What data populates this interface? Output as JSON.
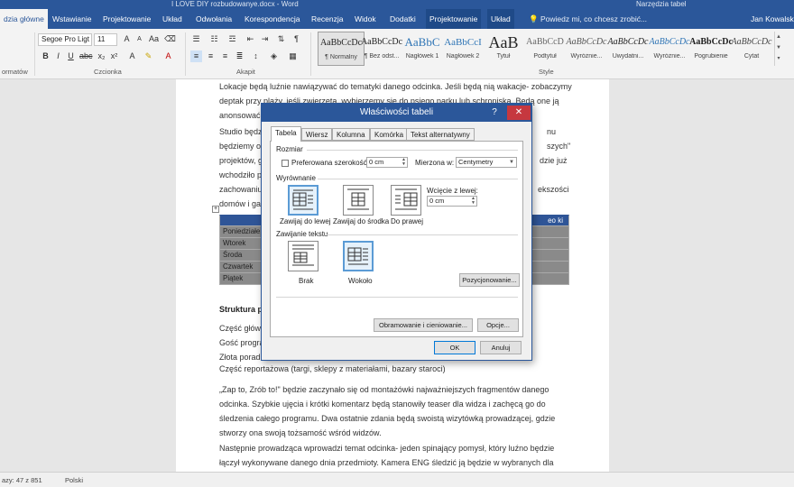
{
  "titlebar": {
    "title": "I LOVE DIY rozbudowanye.docx - Word",
    "context": "Narzędzia tabel"
  },
  "tabs": [
    {
      "label": "dzia główne"
    },
    {
      "label": "Wstawianie"
    },
    {
      "label": "Projektowanie"
    },
    {
      "label": "Układ"
    },
    {
      "label": "Odwołania"
    },
    {
      "label": "Korespondencja"
    },
    {
      "label": "Recenzja"
    },
    {
      "label": "Widok"
    },
    {
      "label": "Dodatki"
    },
    {
      "label": "Projektowanie"
    },
    {
      "label": "Układ"
    }
  ],
  "tellme": "Powiedz mi, co chcesz zrobić...",
  "user": "Jan Kowalski",
  "ribbon": {
    "font_name": "Segoe Pro Ligt",
    "font_size": "11",
    "font_group": "Czcionka",
    "paragraph_group": "Akapit",
    "styles_group": "Style",
    "clipboard_group": "ormatów",
    "styles": [
      {
        "preview": "AaBbCcDc",
        "name": "¶ Normalny"
      },
      {
        "preview": "AaBbCcDc",
        "name": "¶ Bez odst..."
      },
      {
        "preview": "AaBbC",
        "name": "Nagłówek 1"
      },
      {
        "preview": "AaBbCcI",
        "name": "Nagłówek 2"
      },
      {
        "preview": "AaB",
        "name": "Tytuł"
      },
      {
        "preview": "AaBbCcD",
        "name": "Podtytuł"
      },
      {
        "preview": "AaBbCcDc",
        "name": "Wyróżnie..."
      },
      {
        "preview": "AaBbCcDc",
        "name": "Uwydatni..."
      },
      {
        "preview": "AaBbCcDc",
        "name": "Wyróżnie..."
      },
      {
        "preview": "AaBbCcDc",
        "name": "Pogrubienie"
      },
      {
        "preview": "AaBbCcDc",
        "name": "Cytat"
      }
    ]
  },
  "document": {
    "p1": "Lokacje będą luźnie nawiązywać do tematyki danego odcinka. Jeśli będą nią wakacje- zobaczymy deptak przy plaży, jeśli zwierzęta, wybierzemy się do psiego parku lub schroniska. Będą one ją anonsować",
    "p2_start": "Studio będz",
    "p2_l2": "będziemy ol",
    "p2_l3": "projektów, g",
    "p2_l4": "wchodziło p",
    "p2_l5": "zachowaniu",
    "p2_l6": "domów i gar",
    "p2_r1": "nu",
    "p2_r2": "szych\"",
    "p2_r3": "dzie już",
    "p2_r5": "ekszości",
    "table_rows": [
      "Poniedziałe",
      "Wtorek",
      "Środa",
      "Czwartek",
      "Piątek"
    ],
    "table_hdr_right": "eo ki",
    "section_heading": "Struktura pro",
    "list_1": "Część główn",
    "list_2": "Gość progran",
    "list_3": "Złota porad",
    "list_4": "Część reportażowa (targi, sklepy z materiałami, bazary staroci)",
    "p3": "„Zap to, Zrób to!\" będzie zaczynało się od montażówki najważniejszych fragmentów danego odcinka. Szybkie ujęcia i krótki komentarz będą stanowiły teaser dla widza i zachęcą go do śledzenia całego programu. Dwa ostatnie zdania będą swoistą wizytówką prowadzącej, gdzie stworzy ona swoją tożsamość wśród widzów.",
    "p4": "Następnie prowadząca wprowadzi temat odcinka- jeden spinający pomysł, który luźno będzie łączył wykonywane danego dnia przedmioty. Kamera ENG śledzić ją będzie w wybranych dla danego tematu lokalizacjach lub w pięknych przestrzeniach ..."
  },
  "status": {
    "words": "azy: 47 z 851",
    "language": "Polski"
  },
  "dialog": {
    "title": "Właściwości tabeli",
    "help": "?",
    "close": "✕",
    "tabs": [
      "Tabela",
      "Wiersz",
      "Kolumna",
      "Komórka",
      "Tekst alternatywny"
    ],
    "size_label": "Rozmiar",
    "pref_width_label": "Preferowana szerokość:",
    "pref_width_value": "0 cm",
    "measure_label": "Mierzona w:",
    "measure_value": "Centymetry",
    "alignment_label": "Wyrównanie",
    "align_left": "Zawijaj do lewej",
    "align_center": "Zawijaj do środka",
    "align_right": "Do prawej",
    "indent_label": "Wcięcie z lewej:",
    "indent_value": "0 cm",
    "wrap_label": "Zawijanie tekstu",
    "wrap_none": "Brak",
    "wrap_around": "Wokoło",
    "positioning_button": "Pozycjonowanie...",
    "borders_button": "Obramowanie i cieniowanie...",
    "options_button": "Opcje...",
    "ok_button": "OK",
    "cancel_button": "Anuluj"
  }
}
